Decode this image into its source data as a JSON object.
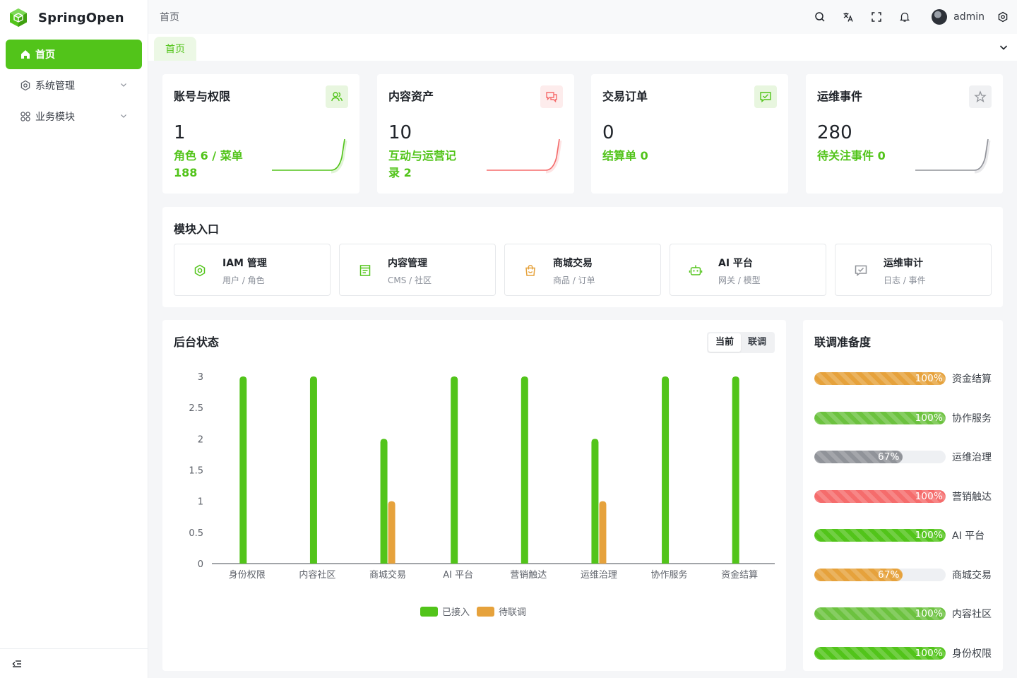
{
  "app": {
    "name": "SpringOpen"
  },
  "sidebar": {
    "items": [
      {
        "label": "首页",
        "icon": "home-icon"
      },
      {
        "label": "系统管理",
        "icon": "gear-icon"
      },
      {
        "label": "业务模块",
        "icon": "grid-icon"
      }
    ]
  },
  "header": {
    "breadcrumb": "首页",
    "user": "admin"
  },
  "tabs": [
    {
      "label": "首页"
    }
  ],
  "colors": {
    "accent": "#52c41a",
    "orange": "#e6a23c",
    "red": "#f56c6c",
    "gray": "#909399"
  },
  "stats": [
    {
      "title": "账号与权限",
      "value": "1",
      "sub": "角色 6 / 菜单 188",
      "icon": "users-icon",
      "color": "#52c41a"
    },
    {
      "title": "内容资产",
      "value": "10",
      "sub": "互动与运营记录 2",
      "icon": "chat-icon",
      "color": "#f56c6c"
    },
    {
      "title": "交易订单",
      "value": "0",
      "sub": "结算单 0",
      "icon": "check-message-icon",
      "color": "#52c41a"
    },
    {
      "title": "运维事件",
      "value": "280",
      "sub": "待关注事件 0",
      "icon": "star-icon",
      "color": "#909399"
    }
  ],
  "modules": {
    "title": "模块入口",
    "items": [
      {
        "name": "IAM 管理",
        "desc": "用户 / 角色",
        "icon": "gear-icon",
        "color": "#52c41a"
      },
      {
        "name": "内容管理",
        "desc": "CMS / 社区",
        "icon": "document-icon",
        "color": "#52c41a"
      },
      {
        "name": "商城交易",
        "desc": "商品 / 订单",
        "icon": "shopping-bag-icon",
        "color": "#e6a23c"
      },
      {
        "name": "AI 平台",
        "desc": "网关 / 模型",
        "icon": "robot-icon",
        "color": "#52c41a"
      },
      {
        "name": "运维审计",
        "desc": "日志 / 事件",
        "icon": "check-message-icon",
        "color": "#909399"
      }
    ]
  },
  "backend": {
    "title": "后台状态",
    "toggle": [
      "当前",
      "联调"
    ]
  },
  "chart_data": {
    "type": "bar",
    "categories": [
      "身份权限",
      "内容社区",
      "商城交易",
      "AI 平台",
      "营销触达",
      "运维治理",
      "协作服务",
      "资金结算"
    ],
    "series": [
      {
        "name": "已接入",
        "color": "#52c41a",
        "values": [
          3,
          3,
          2,
          3,
          3,
          2,
          3,
          3
        ]
      },
      {
        "name": "待联调",
        "color": "#e6a23c",
        "values": [
          0,
          0,
          1,
          0,
          0,
          1,
          0,
          0
        ]
      }
    ],
    "yticks": [
      "0",
      "0.5",
      "1",
      "1.5",
      "2",
      "2.5",
      "3"
    ],
    "ylim": [
      0,
      3
    ],
    "legend": "bottom-center",
    "grid": false
  },
  "readiness": {
    "title": "联调准备度",
    "items": [
      {
        "label": "资金结算",
        "pct": 100,
        "text": "100%",
        "color": "#e6a23c"
      },
      {
        "label": "协作服务",
        "pct": 100,
        "text": "100%",
        "color": "#6cc23f"
      },
      {
        "label": "运维治理",
        "pct": 67,
        "text": "67%",
        "color": "#909399"
      },
      {
        "label": "营销触达",
        "pct": 100,
        "text": "100%",
        "color": "#f56c6c"
      },
      {
        "label": "AI 平台",
        "pct": 100,
        "text": "100%",
        "color": "#52c41a"
      },
      {
        "label": "商城交易",
        "pct": 67,
        "text": "67%",
        "color": "#e6a23c"
      },
      {
        "label": "内容社区",
        "pct": 100,
        "text": "100%",
        "color": "#6cc23f"
      },
      {
        "label": "身份权限",
        "pct": 100,
        "text": "100%",
        "color": "#52c41a"
      }
    ]
  }
}
